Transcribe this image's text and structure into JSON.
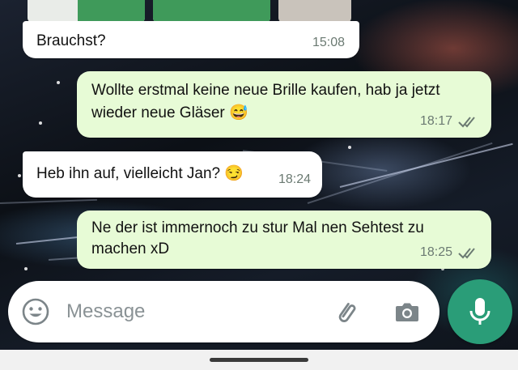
{
  "messages": [
    {
      "direction": "in",
      "text": "Brauchst?",
      "time": "15:08",
      "read": false
    },
    {
      "direction": "out",
      "line1": "Wollte erstmal keine neue Brille kaufen, hab ja jetzt",
      "line2": "wieder neue Gläser",
      "emoji": "😅",
      "time": "18:17",
      "read": true
    },
    {
      "direction": "in",
      "text": "Heb ihn auf, vielleicht Jan?",
      "emoji": "😏",
      "time": "18:24",
      "read": false
    },
    {
      "direction": "out",
      "line1": "Ne der ist immernoch zu stur Mal nen Sehtest zu",
      "line2": "machen xD",
      "time": "18:25",
      "read": true
    }
  ],
  "composer": {
    "placeholder": "Message",
    "emoji_icon": "emoji-icon",
    "attach_icon": "paperclip-icon",
    "camera_icon": "camera-icon",
    "mic_icon": "microphone-icon"
  },
  "colors": {
    "incoming_bubble": "#ffffff",
    "outgoing_bubble": "#e7fbd6",
    "accent": "#2a9d78",
    "read_ticks": "#6b7a72"
  }
}
